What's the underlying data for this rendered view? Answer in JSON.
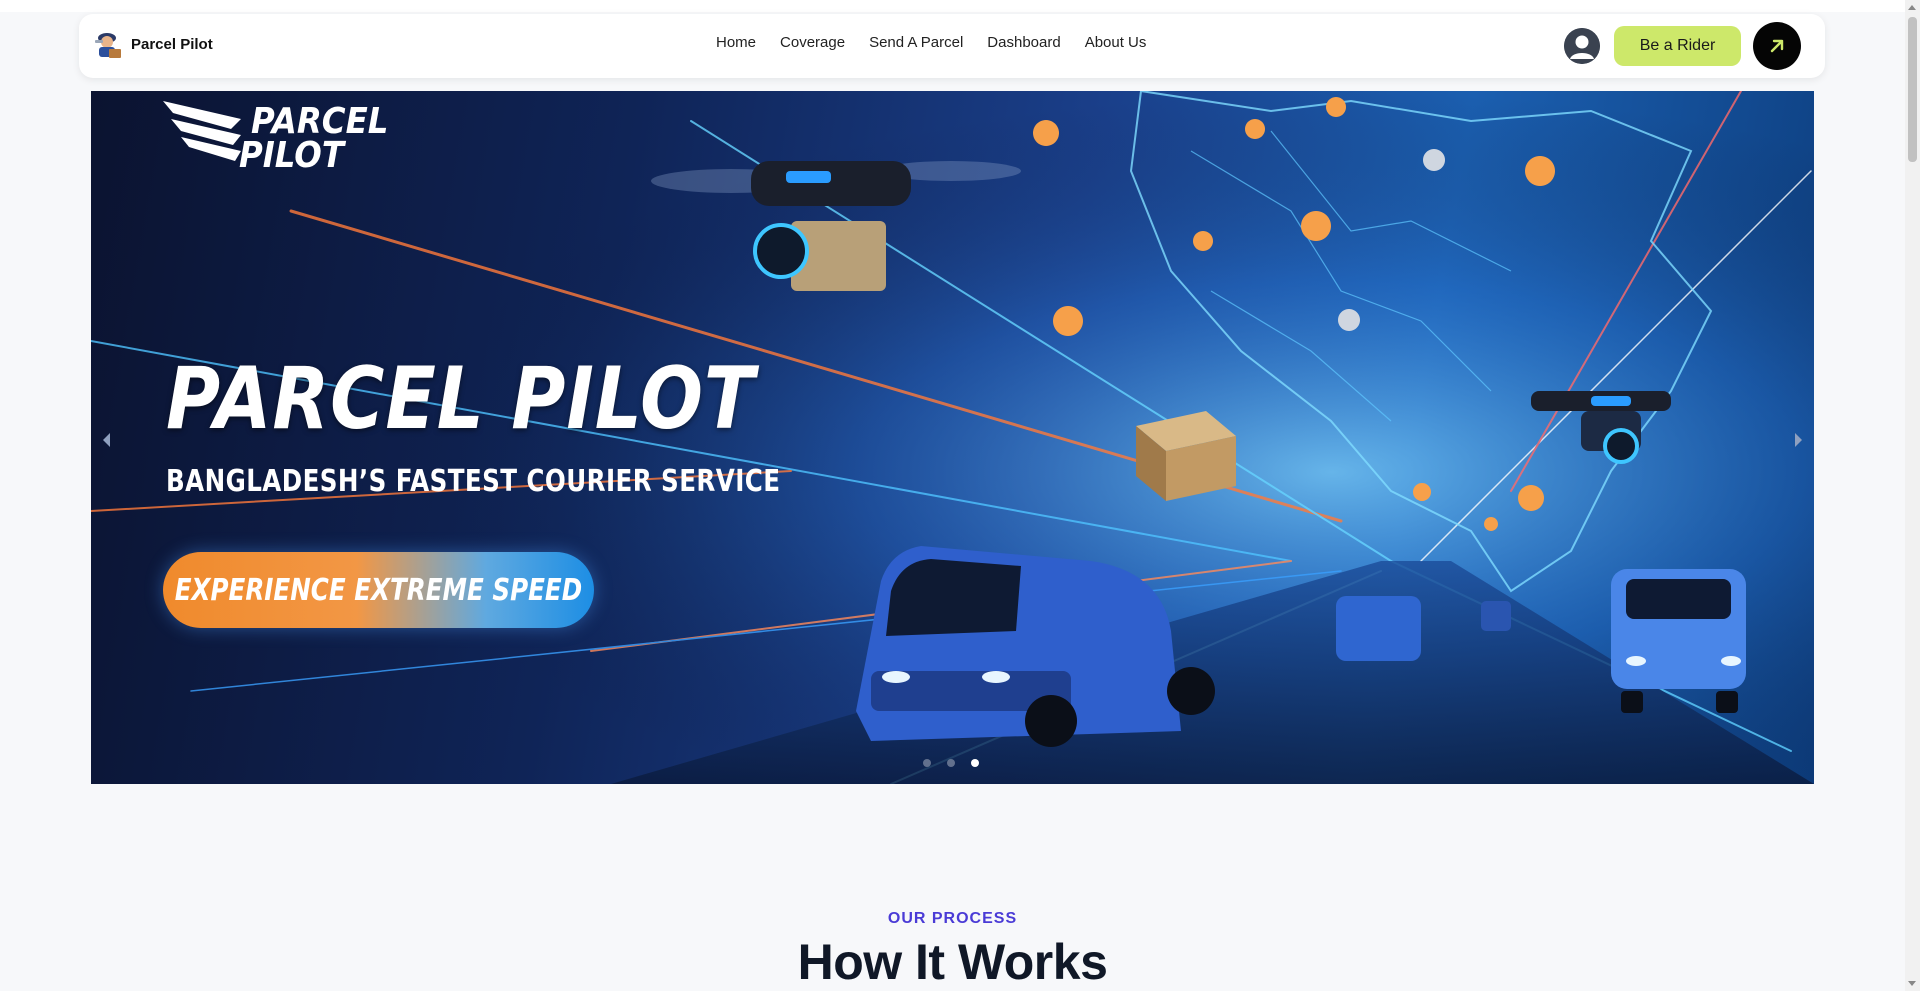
{
  "brand": {
    "name": "Parcel Pilot",
    "logo_icon": "pilot-mascot-icon"
  },
  "nav": {
    "links": [
      "Home",
      "Coverage",
      "Send A Parcel",
      "Dashboard",
      "About Us"
    ]
  },
  "header_actions": {
    "avatar_icon": "user-avatar-icon",
    "rider_button": "Be a Rider",
    "arrow_icon": "arrow-up-right-icon"
  },
  "hero": {
    "logo_line1": "PARCEL",
    "logo_line2": "PILOT",
    "title": "PARCEL PILOT",
    "subtitle": "BANGLADESH’S FASTEST COURIER SERVICE",
    "cta": "EXPERIENCE EXTREME SPEED",
    "slide_count": 3,
    "active_slide": 3
  },
  "process_section": {
    "kicker": "OUR PROCESS",
    "title": "How It Works"
  },
  "colors": {
    "accent_lime": "#cde86a",
    "kicker_purple": "#4a3bd6",
    "cta_orange": "#f08a2c",
    "cta_blue": "#1d8ee4"
  }
}
